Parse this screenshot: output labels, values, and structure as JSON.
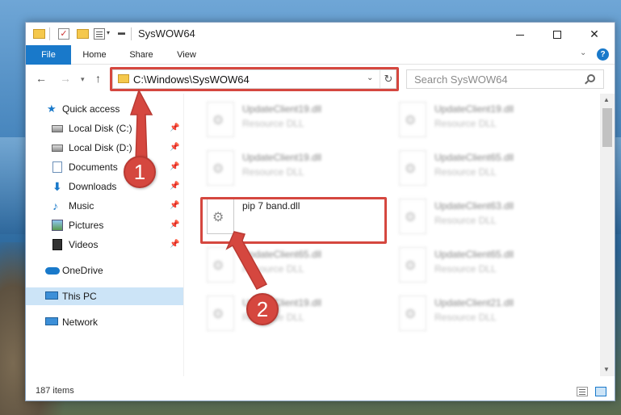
{
  "window": {
    "title": "SysWOW64"
  },
  "ribbon": {
    "tabs": [
      "File",
      "Home",
      "Share",
      "View"
    ],
    "help": "?"
  },
  "address": {
    "path": "C:\\Windows\\SysWOW64",
    "search_placeholder": "Search SysWOW64"
  },
  "sidebar": {
    "items": [
      {
        "label": "Quick access",
        "pinned": false
      },
      {
        "label": "Local Disk (C:)",
        "pinned": true
      },
      {
        "label": "Local Disk (D:)",
        "pinned": true
      },
      {
        "label": "Documents",
        "pinned": true
      },
      {
        "label": "Downloads",
        "pinned": true
      },
      {
        "label": "Music",
        "pinned": true
      },
      {
        "label": "Pictures",
        "pinned": true
      },
      {
        "label": "Videos",
        "pinned": true
      },
      {
        "label": "OneDrive",
        "pinned": false
      },
      {
        "label": "This PC",
        "pinned": false,
        "selected": true
      },
      {
        "label": "Network",
        "pinned": false
      }
    ]
  },
  "files": {
    "left": [
      {
        "name": "UpdateClient19.dll",
        "type": "Resource DLL"
      },
      {
        "name": "UpdateClient19.dll",
        "type": "Resource DLL"
      },
      {
        "name": "pip 7 band.dll",
        "type": ""
      },
      {
        "name": "UpdateClient65.dll",
        "type": "Resource DLL"
      },
      {
        "name": "UpdateClient19.dll",
        "type": "Resource DLL"
      }
    ],
    "right": [
      {
        "name": "UpdateClient19.dll",
        "type": "Resource DLL"
      },
      {
        "name": "UpdateClient65.dll",
        "type": "Resource DLL"
      },
      {
        "name": "UpdateClient63.dll",
        "type": "Resource DLL"
      },
      {
        "name": "UpdateClient65.dll",
        "type": "Resource DLL"
      },
      {
        "name": "UpdateClient21.dll",
        "type": "Resource DLL"
      }
    ]
  },
  "status": {
    "item_count": "187 items"
  },
  "annotations": {
    "step1": "1",
    "step2": "2"
  },
  "colors": {
    "accent": "#1979ca",
    "highlight": "#d5473f",
    "selected_bg": "#cce4f7"
  }
}
